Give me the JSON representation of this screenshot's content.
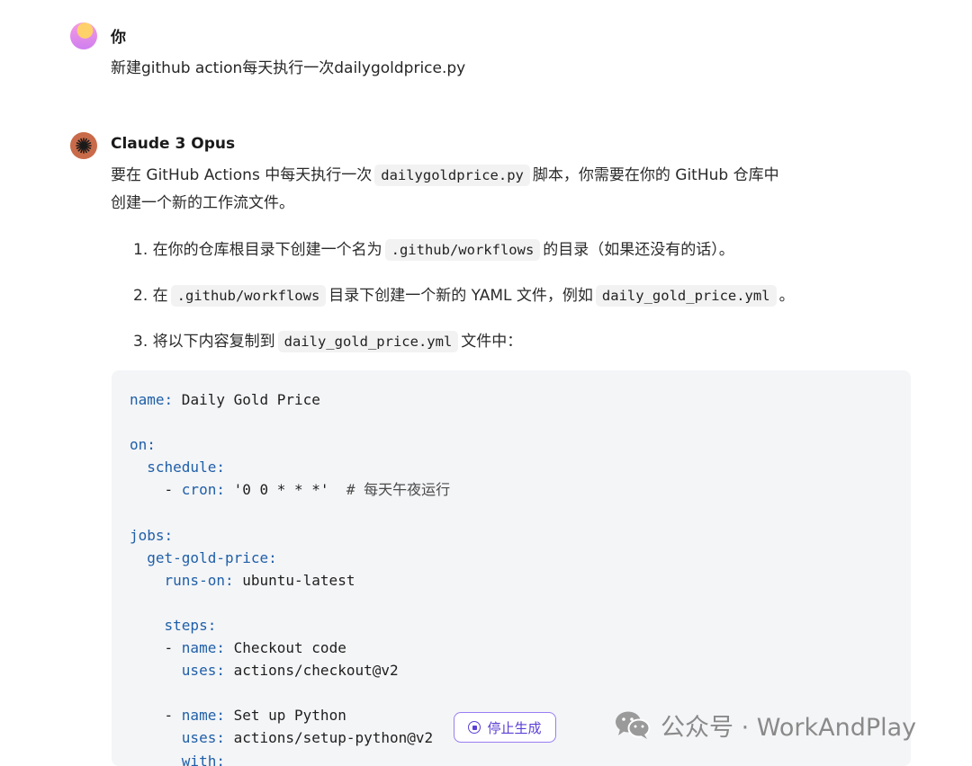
{
  "user": {
    "name": "你",
    "message": "新建github action每天执行一次dailygoldprice.py"
  },
  "assistant": {
    "name": "Claude 3 Opus",
    "intro": {
      "pre": "要在 GitHub Actions 中每天执行一次",
      "code": "dailygoldprice.py",
      "post1": "脚本，你需要在你的 GitHub 仓库中",
      "post2": "创建一个新的工作流文件。"
    },
    "steps": [
      {
        "num": "1.",
        "pre": "在你的仓库根目录下创建一个名为",
        "code": ".github/workflows",
        "post": "的目录（如果还没有的话）。"
      },
      {
        "num": "2.",
        "pre": "在",
        "code": ".github/workflows",
        "mid": "目录下创建一个新的 YAML 文件，例如",
        "code2": "daily_gold_price.yml",
        "post": "。"
      },
      {
        "num": "3.",
        "pre": "将以下内容复制到",
        "code": "daily_gold_price.yml",
        "post": "文件中："
      }
    ],
    "code": {
      "l1k": "name:",
      "l1v": " Daily Gold Price",
      "l3k": "on:",
      "l4k": "schedule:",
      "l5d": "- ",
      "l5k": "cron:",
      "l5v": " '0 0 * * *'",
      "l5c": "  # 每天午夜运行",
      "l7k": "jobs:",
      "l8k": "get-gold-price:",
      "l9k": "runs-on:",
      "l9v": " ubuntu-latest",
      "l11k": "steps:",
      "l12d": "- ",
      "l12k": "name:",
      "l12v": " Checkout code",
      "l13k": "uses:",
      "l13v": " actions/checkout@v2",
      "l15d": "- ",
      "l15k": "name:",
      "l15v": " Set up Python",
      "l16k": "uses:",
      "l16v": " actions/setup-python@v2",
      "l17k": "with:"
    }
  },
  "stop_button": {
    "label": "停止生成"
  },
  "watermark": {
    "text": "公众号 · WorkAndPlay"
  }
}
